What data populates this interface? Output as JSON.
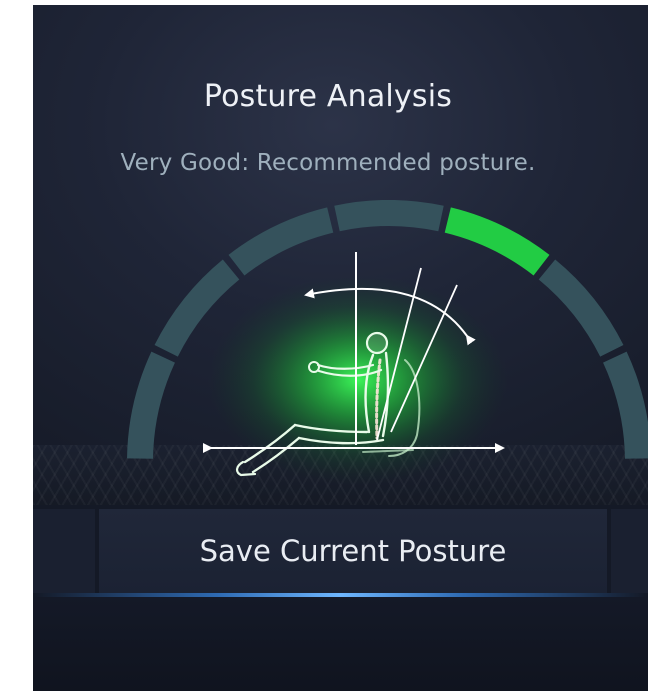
{
  "header": {
    "title": "Posture Analysis",
    "status": "Very Good: Recommended posture."
  },
  "gauge": {
    "segment_count": 7,
    "active_segment": 4,
    "active_color": "#22cc44",
    "inactive_color": "#35525c",
    "glow_color": "#1fd13a"
  },
  "actions": {
    "save_label": "Save Current Posture"
  },
  "colors": {
    "background": "#1d2333",
    "accent": "#6fb7ff"
  }
}
